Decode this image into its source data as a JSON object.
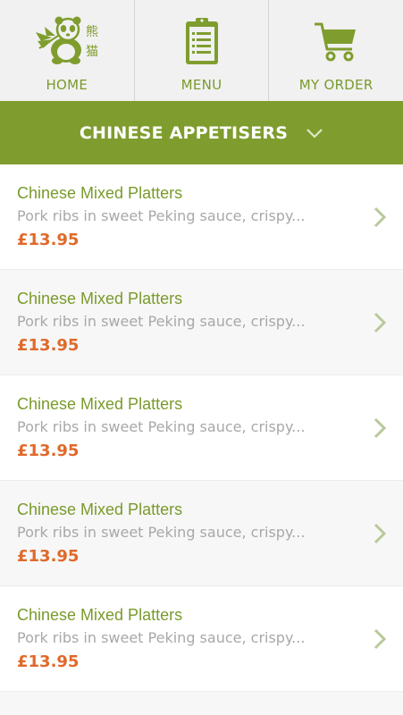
{
  "nav": {
    "home_label": "HOME",
    "menu_label": "MENU",
    "order_label": "MY ORDER"
  },
  "logo": {
    "chinese_chars": [
      "熊",
      "猫"
    ]
  },
  "category": {
    "title": "CHINESE APPETISERS"
  },
  "colors": {
    "accent_green": "#7f9d2e",
    "text_green": "#7a9a2b",
    "price_orange": "#e0692a",
    "desc_grey": "#a8a8a8"
  },
  "items": [
    {
      "name": "Chinese Mixed Platters",
      "description": "Pork ribs in sweet Peking sauce, crispy...",
      "price": "£13.95"
    },
    {
      "name": "Chinese Mixed Platters",
      "description": "Pork ribs in sweet Peking sauce, crispy...",
      "price": "£13.95"
    },
    {
      "name": "Chinese Mixed Platters",
      "description": "Pork ribs in sweet Peking sauce, crispy...",
      "price": "£13.95"
    },
    {
      "name": "Chinese Mixed Platters",
      "description": "Pork ribs in sweet Peking sauce, crispy...",
      "price": "£13.95"
    },
    {
      "name": "Chinese Mixed Platters",
      "description": "Pork ribs in sweet Peking sauce, crispy...",
      "price": "£13.95"
    }
  ]
}
